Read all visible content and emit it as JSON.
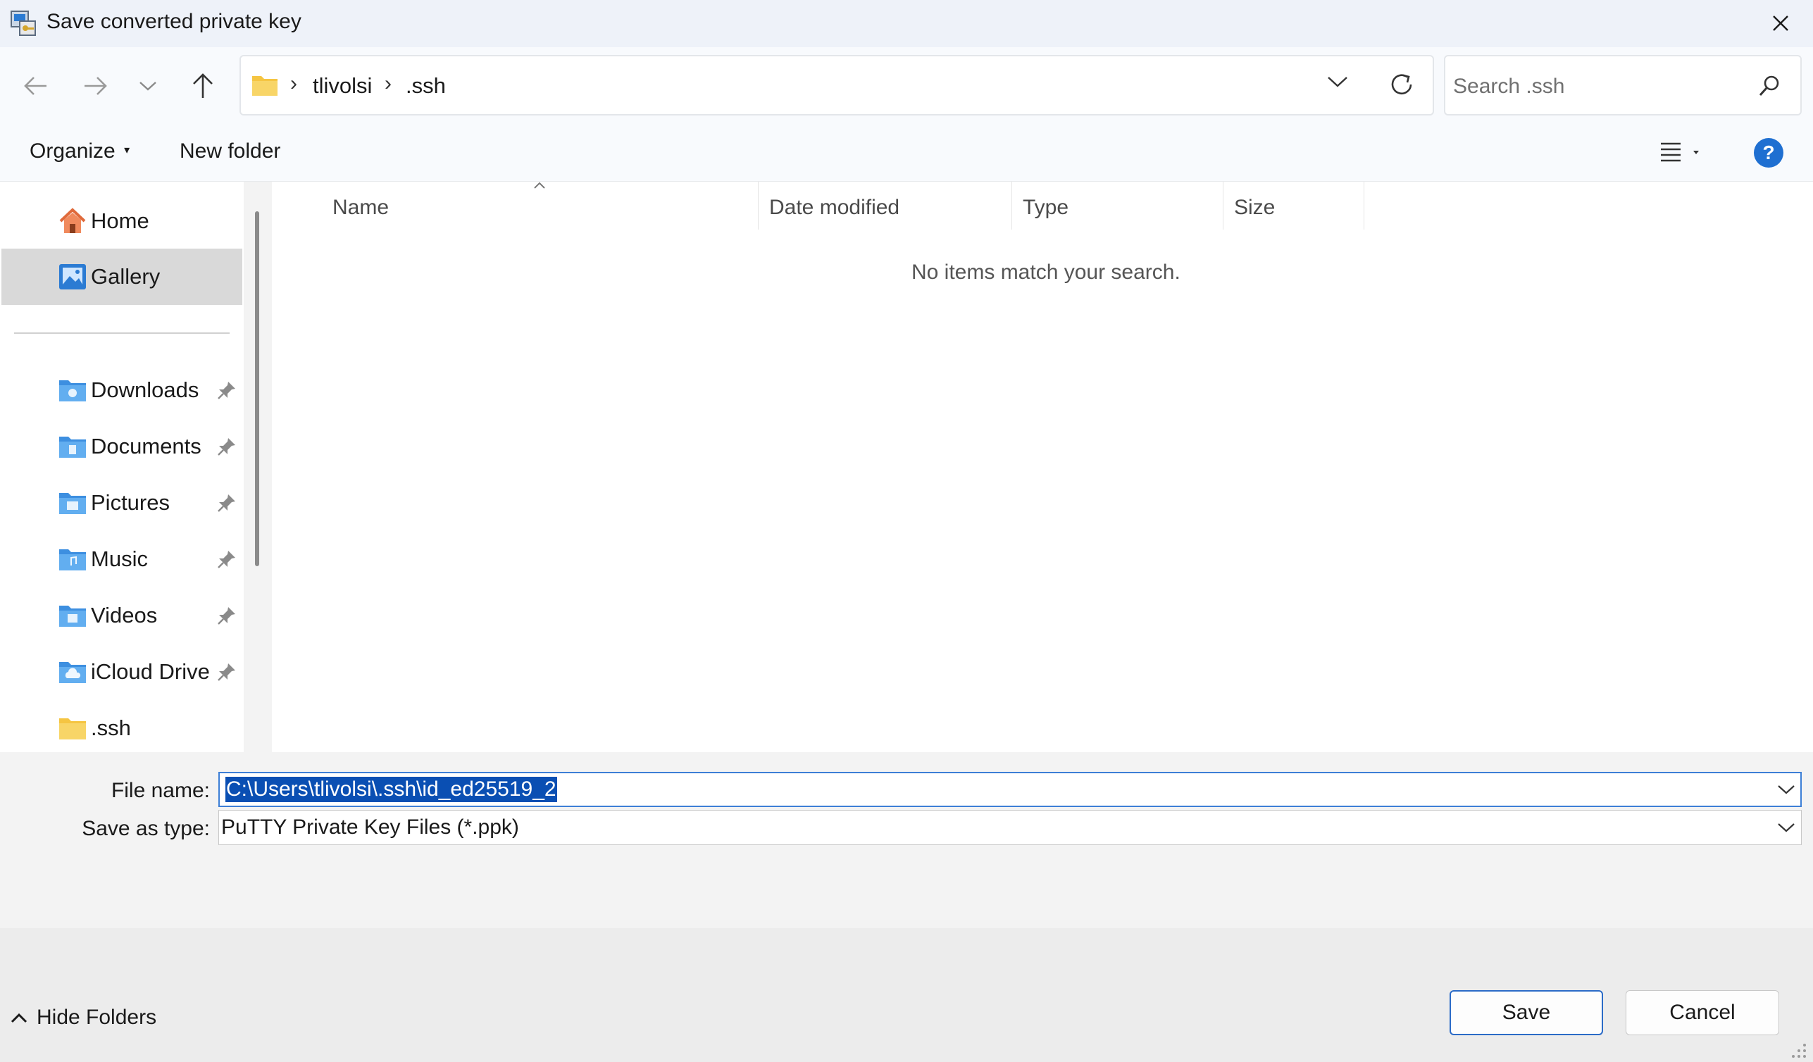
{
  "window": {
    "title": "Save converted private key",
    "close_icon": "close-icon",
    "app_icon": "key-app-icon"
  },
  "nav": {
    "back_icon": "arrow-left-icon",
    "forward_icon": "arrow-right-icon",
    "recent_icon": "chevron-down-icon",
    "up_icon": "arrow-up-icon"
  },
  "address": {
    "crumbs": [
      "tlivolsi",
      ".ssh"
    ],
    "separator": "›",
    "refresh_icon": "refresh-icon"
  },
  "search": {
    "placeholder": "Search .ssh"
  },
  "toolbar": {
    "organize_label": "Organize",
    "new_folder_label": "New folder",
    "view_icon": "list-view-icon",
    "help_icon": "help-icon",
    "help_glyph": "?"
  },
  "sidebar": {
    "items": [
      {
        "label": "Home",
        "icon": "home-icon",
        "pinned": false
      },
      {
        "label": "Gallery",
        "icon": "gallery-icon",
        "pinned": false,
        "selected": true
      },
      {
        "label": "Downloads",
        "icon": "downloads-folder-icon",
        "pinned": true
      },
      {
        "label": "Documents",
        "icon": "documents-folder-icon",
        "pinned": true
      },
      {
        "label": "Pictures",
        "icon": "pictures-folder-icon",
        "pinned": true
      },
      {
        "label": "Music",
        "icon": "music-folder-icon",
        "pinned": true
      },
      {
        "label": "Videos",
        "icon": "videos-folder-icon",
        "pinned": true
      },
      {
        "label": "iCloud Drive (",
        "icon": "icloud-folder-icon",
        "pinned": true
      },
      {
        "label": ".ssh",
        "icon": "folder-icon",
        "pinned": false
      }
    ]
  },
  "file_list": {
    "columns": [
      "Name",
      "Date modified",
      "Type",
      "Size"
    ],
    "empty_message": "No items match your search."
  },
  "form": {
    "file_name_label": "File name:",
    "file_name_value": "C:\\Users\\tlivolsi\\.ssh\\id_ed25519_2",
    "save_as_type_label": "Save as type:",
    "save_as_type_value": "PuTTY Private Key Files (*.ppk)"
  },
  "footer": {
    "hide_folders_label": "Hide Folders",
    "save_label": "Save",
    "cancel_label": "Cancel"
  },
  "colors": {
    "accent": "#0a4fb3",
    "help_blue": "#1f6fd1",
    "folder_yellow": "#f5c542",
    "folder_blue": "#3d8fe0"
  }
}
